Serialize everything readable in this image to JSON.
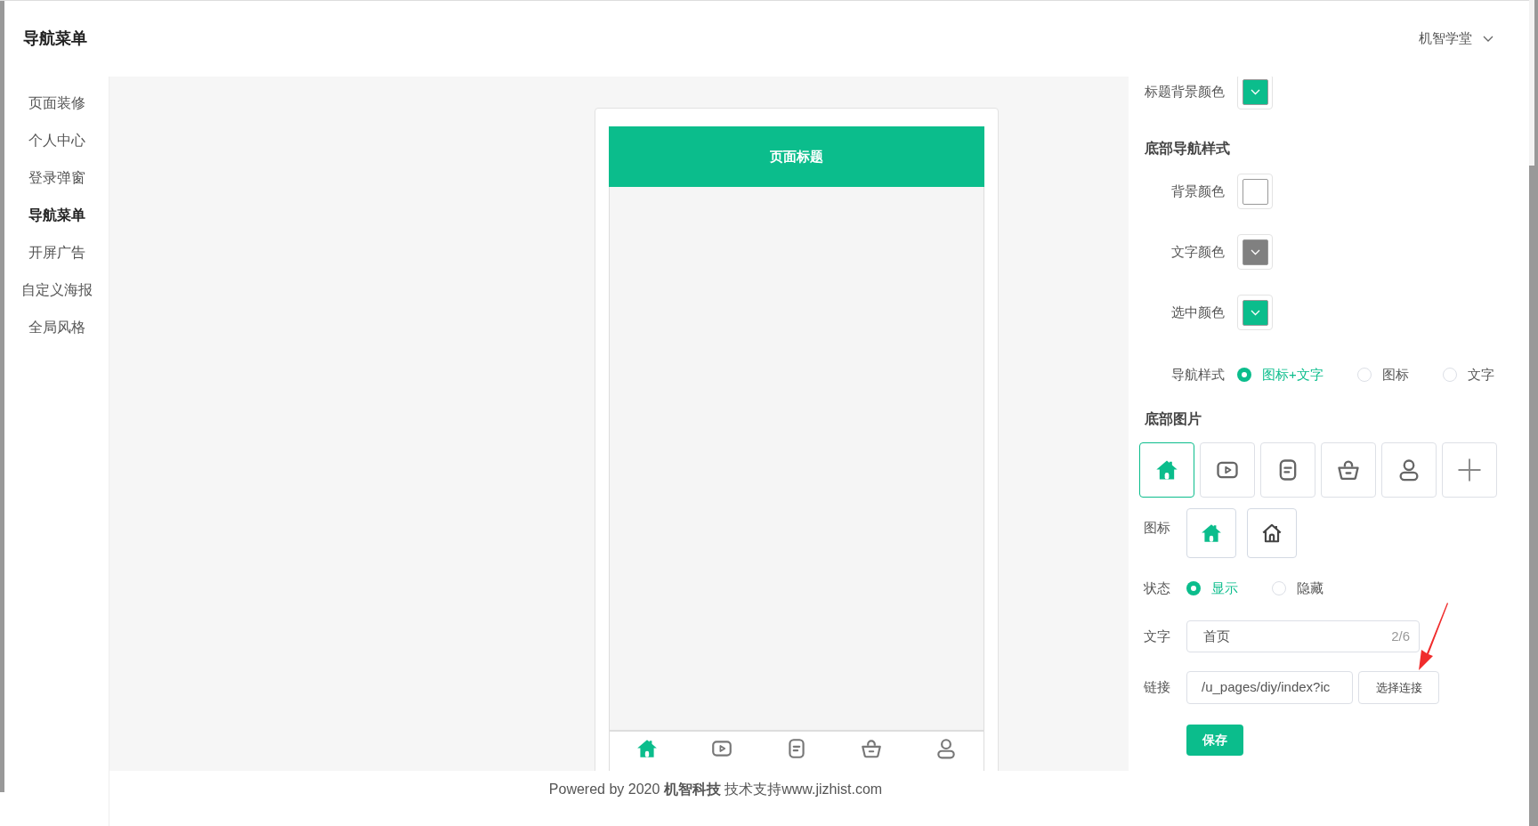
{
  "header": {
    "title": "导航菜单",
    "account": "机智学堂"
  },
  "sidebar": {
    "items": [
      {
        "label": "页面装修",
        "selected": false
      },
      {
        "label": "个人中心",
        "selected": false
      },
      {
        "label": "登录弹窗",
        "selected": false
      },
      {
        "label": "导航菜单",
        "selected": true
      },
      {
        "label": "开屏广告",
        "selected": false
      },
      {
        "label": "自定义海报",
        "selected": false
      },
      {
        "label": "全局风格",
        "selected": false
      }
    ]
  },
  "preview": {
    "title": "页面标题",
    "tabs": [
      {
        "kind": "home",
        "selected": true
      },
      {
        "kind": "play",
        "selected": false
      },
      {
        "kind": "doc",
        "selected": false
      },
      {
        "kind": "basket",
        "selected": false
      },
      {
        "kind": "person",
        "selected": false
      }
    ]
  },
  "settings": {
    "title_background": {
      "label": "标题背景颜色",
      "color": "#0bbd8c"
    },
    "nav_section": "底部导航样式",
    "colors": [
      {
        "label": "背景颜色",
        "color": "#ffffff"
      },
      {
        "label": "文字颜色",
        "color": "#808080"
      },
      {
        "label": "选中颜色",
        "color": "#0bbd8c"
      }
    ],
    "nav_style": {
      "label": "导航样式",
      "options": [
        {
          "label": "图标+文字",
          "selected": true
        },
        {
          "label": "图标",
          "selected": false
        },
        {
          "label": "文字",
          "selected": false
        }
      ]
    },
    "image_section": "底部图片",
    "image_tiles": [
      {
        "kind": "home",
        "selected": true
      },
      {
        "kind": "play",
        "selected": false
      },
      {
        "kind": "doc",
        "selected": false
      },
      {
        "kind": "basket",
        "selected": false
      },
      {
        "kind": "person",
        "selected": false
      },
      {
        "kind": "plus",
        "selected": false
      }
    ],
    "icon_row": {
      "label": "图标",
      "icons": [
        {
          "kind": "filled"
        },
        {
          "kind": "outline"
        }
      ]
    },
    "status": {
      "label": "状态",
      "options": [
        {
          "label": "显示",
          "selected": true
        },
        {
          "label": "隐藏",
          "selected": false
        }
      ]
    },
    "text_field": {
      "label": "文字",
      "value": "首页",
      "counter": "2/6"
    },
    "link_field": {
      "label": "链接",
      "value": "/u_pages/diy/index?ic",
      "button": "选择连接"
    },
    "save_button": "保存"
  },
  "footer": "Powered by 2020 **机智科技** 技术支持www.jizhist.com"
}
